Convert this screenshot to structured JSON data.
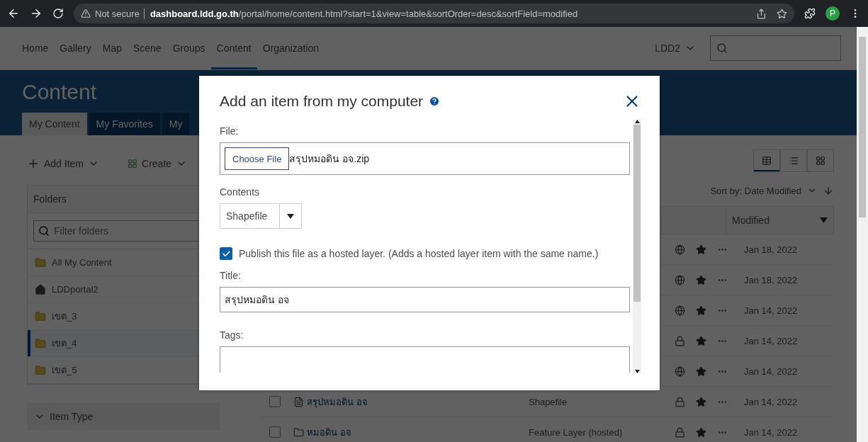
{
  "browser": {
    "security": "Not secure",
    "host": "dashboard.ldd.go.th",
    "path": "/portal/home/content.html?start=1&view=table&sortOrder=desc&sortField=modified",
    "avatar": "P"
  },
  "nav": {
    "items": [
      {
        "label": "Home",
        "selected": false
      },
      {
        "label": "Gallery",
        "selected": false
      },
      {
        "label": "Map",
        "selected": false
      },
      {
        "label": "Scene",
        "selected": false
      },
      {
        "label": "Groups",
        "selected": false
      },
      {
        "label": "Content",
        "selected": true
      },
      {
        "label": "Organization",
        "selected": false
      }
    ],
    "user": "LDD2"
  },
  "banner": {
    "title": "Content",
    "tabs": [
      {
        "label": "My Content",
        "selected": true
      },
      {
        "label": "My Favorites",
        "selected": false
      },
      {
        "label": "My",
        "selected": false
      }
    ]
  },
  "toolbar": {
    "add_item": "Add Item",
    "create": "Create",
    "views": [
      {
        "kind": "table",
        "selected": true
      },
      {
        "kind": "list",
        "selected": false
      },
      {
        "kind": "grid",
        "selected": false
      }
    ],
    "sort": "Sort by: Date Modified"
  },
  "folders": {
    "header": "Folders",
    "filter_placeholder": "Filter folders",
    "items": [
      {
        "label": "All My Content",
        "kind": "all",
        "selected": false
      },
      {
        "label": "LDDportal2",
        "kind": "home",
        "selected": false
      },
      {
        "label": "เขต_3",
        "kind": "folder",
        "selected": false
      },
      {
        "label": "เขต_4",
        "kind": "folder",
        "selected": true
      },
      {
        "label": "เขต_5",
        "kind": "folder",
        "selected": false
      }
    ]
  },
  "filter_section": {
    "label": "Item Type",
    "expanded": true
  },
  "table": {
    "modified_column": "Modified",
    "rows": [
      {
        "kind": "public",
        "modified": "Jan 18, 2022"
      },
      {
        "kind": "public",
        "modified": "Jan 18, 2022"
      },
      {
        "kind": "public",
        "modified": "Jan 14, 2022"
      },
      {
        "kind": "private",
        "modified": "Jan 14, 2022"
      },
      {
        "kind": "public",
        "modified": "Jan 14, 2022"
      },
      {
        "title": "สรุปหมอดิน อจ",
        "type": "Shapefile",
        "kind": "private",
        "checked": false,
        "modified": "Jan 14, 2022"
      },
      {
        "title": "หมอดิน อจ",
        "type": "Feature Layer (hosted)",
        "kind": "private",
        "checked": false,
        "modified": "Jan 14, 2022"
      }
    ]
  },
  "modal": {
    "title": "Add an item from my computer",
    "file_label": "File:",
    "choose_button": "Choose File",
    "file_name": "สรุปหมอดิน อจ.zip",
    "contents_label": "Contents",
    "contents_value": "Shapefile",
    "publish": {
      "checked": true,
      "label": "Publish this file as a hosted layer. (Adds a hosted layer item with the same name.)"
    },
    "title_label": "Title:",
    "title_value": "สรุปหมอดิน อจ",
    "tags_label": "Tags:"
  }
}
